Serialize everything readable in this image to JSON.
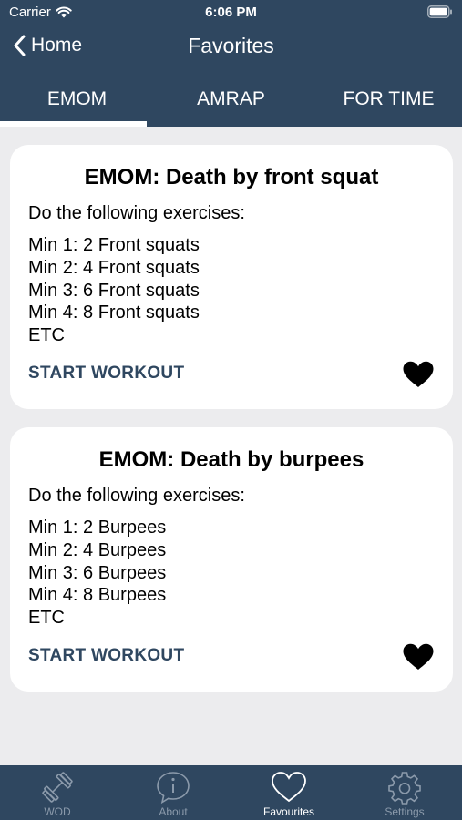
{
  "status_bar": {
    "carrier": "Carrier",
    "time": "6:06 PM"
  },
  "nav": {
    "back_label": "Home",
    "title": "Favorites"
  },
  "tabs": [
    {
      "label": "EMOM"
    },
    {
      "label": "AMRAP"
    },
    {
      "label": "FOR TIME"
    }
  ],
  "workouts": [
    {
      "title": "EMOM: Death by front squat",
      "intro": "Do the following exercises:",
      "lines": [
        "Min 1: 2 Front squats",
        "Min 2: 4 Front squats",
        "Min 3: 6 Front squats",
        "Min 4: 8 Front squats",
        "ETC"
      ],
      "action": "START WORKOUT",
      "favorite": true
    },
    {
      "title": "EMOM: Death by burpees",
      "intro": "Do the following exercises:",
      "lines": [
        "Min 1: 2 Burpees",
        "Min 2: 4 Burpees",
        "Min 3: 6 Burpees",
        "Min 4: 8 Burpees",
        "ETC"
      ],
      "action": "START WORKOUT",
      "favorite": true
    }
  ],
  "tab_bar": [
    {
      "label": "WOD",
      "icon": "dumbbell-icon"
    },
    {
      "label": "About",
      "icon": "info-icon"
    },
    {
      "label": "Favourites",
      "icon": "heart-icon"
    },
    {
      "label": "Settings",
      "icon": "gear-icon"
    }
  ],
  "colors": {
    "primary": "#2f4760",
    "background": "#ececee",
    "card": "#ffffff",
    "inactive": "#8b9aab"
  }
}
